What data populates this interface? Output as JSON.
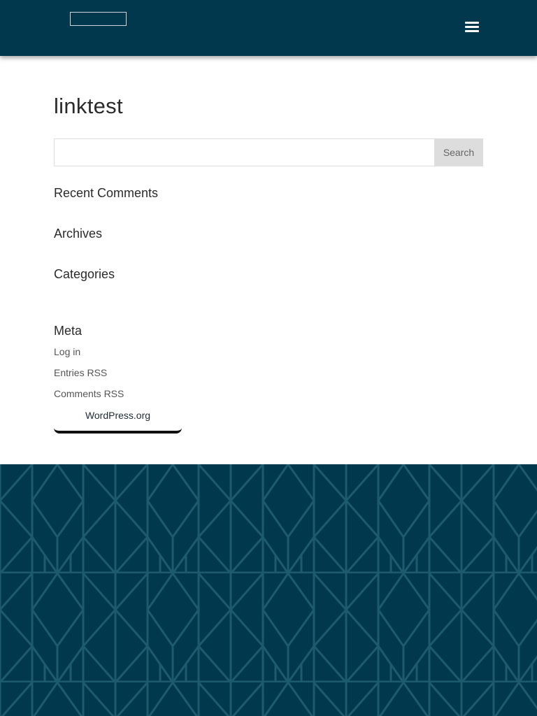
{
  "header": {
    "logo": "",
    "menu_icon": "hamburger-menu-icon"
  },
  "page": {
    "title": "linktest"
  },
  "search": {
    "value": "",
    "placeholder": "",
    "button_label": "Search"
  },
  "widgets": {
    "recent_comments": "Recent Comments",
    "archives": "Archives",
    "categories": "Categories",
    "meta": "Meta"
  },
  "meta_links": {
    "login": "Log in",
    "entries_rss": "Entries RSS",
    "comments_rss": "Comments RSS",
    "wordpress": "WordPress.org"
  },
  "colors": {
    "header_bg": "#02384d",
    "footer_bg": "#02384d",
    "footer_pattern": "#1e5a6e",
    "search_button_bg": "#dddddd"
  }
}
